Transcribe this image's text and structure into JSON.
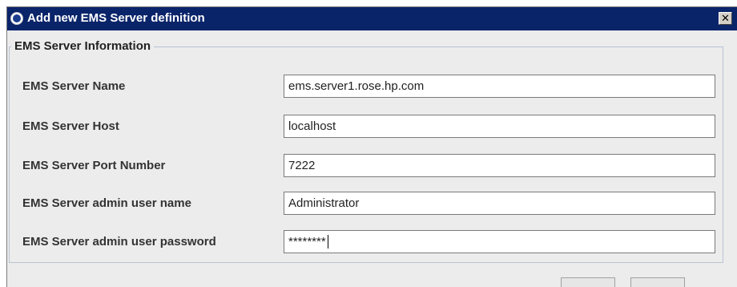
{
  "window": {
    "title": "Add new EMS Server definition",
    "close_glyph": "✕"
  },
  "section": {
    "legend": "EMS Server Information"
  },
  "fields": [
    {
      "label": "EMS Server Name",
      "value": "ems.server1.rose.hp.com"
    },
    {
      "label": "EMS Server Host",
      "value": "localhost"
    },
    {
      "label": "EMS Server Port Number",
      "value": "7222"
    },
    {
      "label": "EMS Server admin user name",
      "value": "Administrator"
    },
    {
      "label": "EMS Server admin user password",
      "value": "********"
    }
  ],
  "icons": {
    "app": "hp-logo-icon",
    "close": "close-icon"
  },
  "colors": {
    "titlebar": "#0a246a",
    "dialog_bg": "#ececec",
    "group_border": "#b8c4d4"
  }
}
